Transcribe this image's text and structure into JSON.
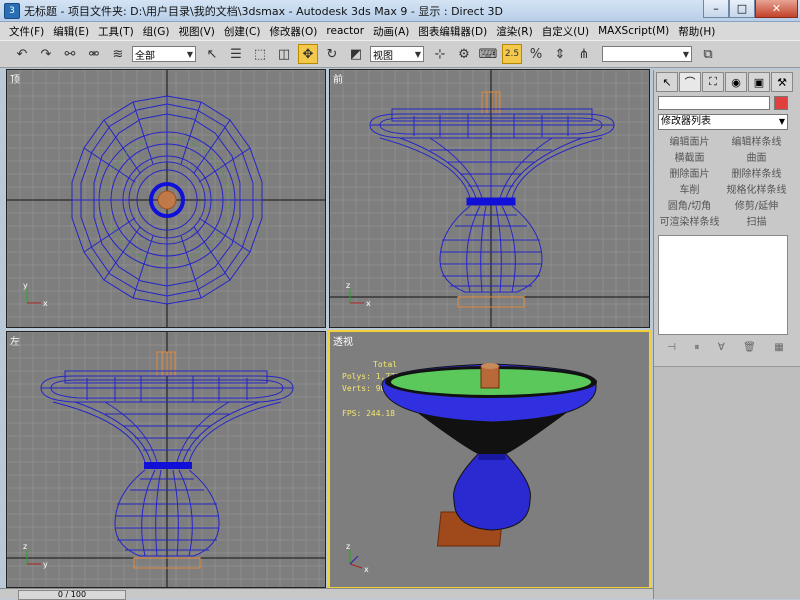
{
  "window": {
    "app_icon": "3ds-max-icon",
    "title": "无标题    - 项目文件夹: D:\\用户目录\\我的文档\\3dsmax     - Autodesk 3ds Max 9     - 显示 : Direct 3D",
    "minimize": "–",
    "maximize": "□",
    "close": "✕"
  },
  "menu": [
    "文件(F)",
    "编辑(E)",
    "工具(T)",
    "组(G)",
    "视图(V)",
    "创建(C)",
    "修改器(O)",
    "reactor",
    "动画(A)",
    "图表编辑器(D)",
    "渲染(R)",
    "自定义(U)",
    "MAXScript(M)",
    "帮助(H)"
  ],
  "toolbar": {
    "selection_filter": "全部",
    "ref_coord": "视图",
    "snap_angle": "2.5",
    "named_sel": ""
  },
  "viewports": {
    "top": {
      "label": "顶"
    },
    "front": {
      "label": "前"
    },
    "left": {
      "label": "左"
    },
    "perspective": {
      "label": "透视",
      "stats_title": "Total",
      "polys": "Polys: 1,772",
      "verts": "Verts: 908",
      "fps": "FPS:   244.18"
    }
  },
  "axes": {
    "x": "x",
    "y": "y",
    "z": "z"
  },
  "command_panel": {
    "modifier_list": "修改器列表",
    "buttons": [
      "编辑面片",
      "编辑样条线",
      "横截面",
      "曲面",
      "删除面片",
      "删除样条线",
      "车削",
      "规格化样条线",
      "圆角/切角",
      "修剪/延伸",
      "可渲染样条线",
      "扫描"
    ],
    "color_swatch": "#e04040"
  },
  "status": {
    "time": "0 / 100"
  },
  "colors": {
    "viewport_bg": "#7e7e7e",
    "wire": "#2525c8",
    "active_border": "#f2d03a"
  }
}
